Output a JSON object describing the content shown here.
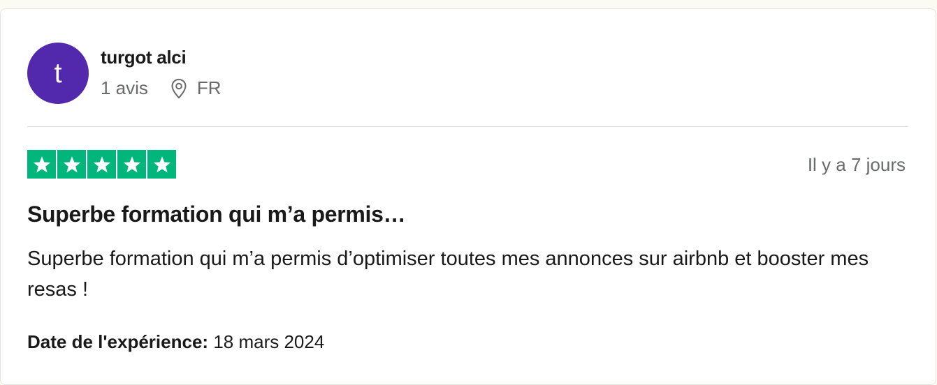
{
  "review": {
    "avatar_initial": "t",
    "avatar_color": "#5228ad",
    "reviewer_name": "turgot alci",
    "review_count": "1 avis",
    "location_icon": "location-pin-icon",
    "country": "FR",
    "rating": 5,
    "rating_max": 5,
    "star_color": "#00b67a",
    "time_ago": "Il y a 7 jours",
    "title": "Superbe formation qui m’a permis…",
    "text": "Superbe formation qui m’a permis d’optimiser toutes mes annonces sur airbnb et booster mes resas !",
    "experience_label": "Date de l'expérience:",
    "experience_date": "18 mars 2024"
  }
}
